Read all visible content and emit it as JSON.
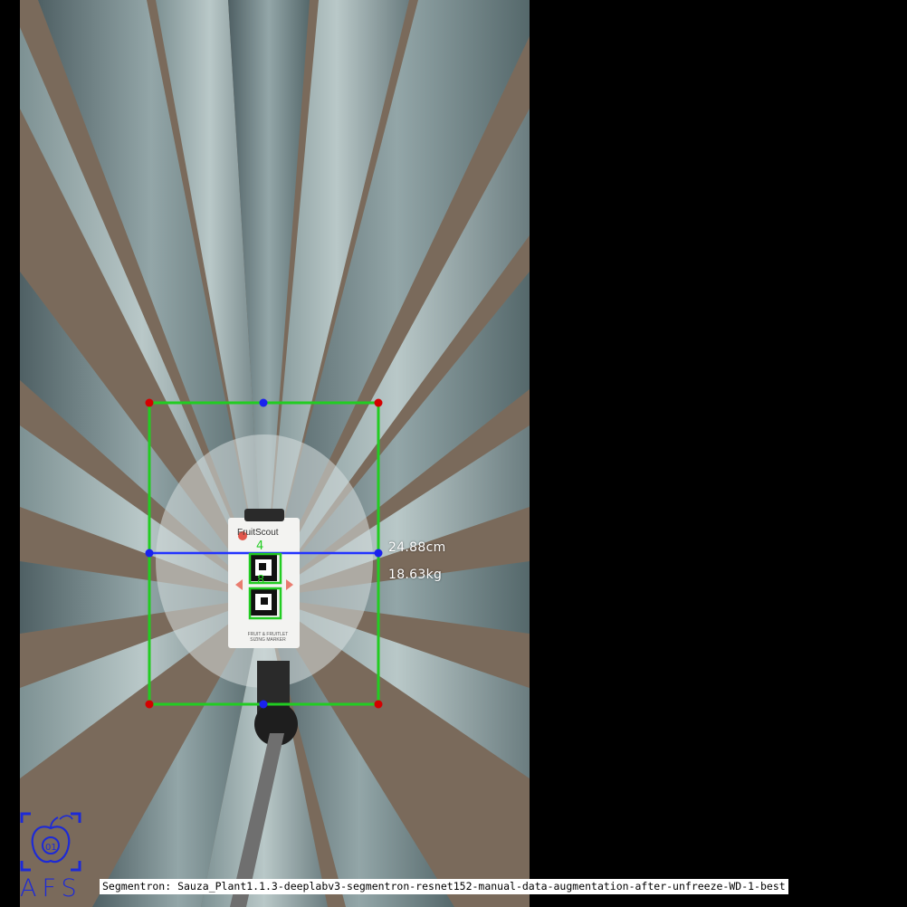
{
  "measurement": {
    "width_label": "24.88cm",
    "weight_label": "18.63kg"
  },
  "marker": {
    "brand": "FruitScout",
    "footer_line1": "FRUIT & FRUITLET",
    "footer_line2": "SIZING MARKER",
    "ids": [
      "4",
      "8"
    ]
  },
  "logo": {
    "text": "AFS",
    "badge_number": "01"
  },
  "caption": {
    "text": "Segmentron: Sauza_Plant1.1.3-deeplabv3-segmentron-resnet152-manual-data-augmentation-after-unfreeze-WD-1-best"
  },
  "colors": {
    "bbox": "#22cc22",
    "corner_points": "#d40000",
    "mid_points": "#1a22ee",
    "width_line": "#2233ff",
    "logo": "#1d2ad6",
    "background": "#000000"
  }
}
